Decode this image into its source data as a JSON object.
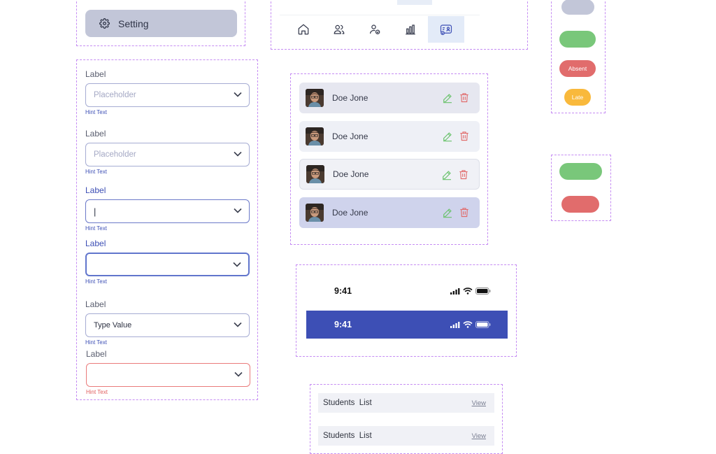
{
  "setting": {
    "label": "Setting",
    "icon": "gear-icon"
  },
  "form": {
    "fields": [
      {
        "label": "Label",
        "placeholder": "Placeholder",
        "value": "",
        "hint": "Hint Text",
        "state": "default"
      },
      {
        "label": "Label",
        "placeholder": "Placeholder",
        "value": "",
        "hint": "Hint Text",
        "state": "hover"
      },
      {
        "label": "Label",
        "placeholder": "",
        "value": "|",
        "hint": "Hint Text",
        "state": "typing"
      },
      {
        "label": "Label",
        "placeholder": "",
        "value": "",
        "hint": "Hint Text",
        "state": "focused"
      },
      {
        "label": "Label",
        "placeholder": "",
        "value": "Type Value",
        "hint": "Hint Text",
        "state": "filled"
      },
      {
        "label": "Label",
        "placeholder": "",
        "value": "",
        "hint": "Hint Text",
        "state": "error"
      }
    ]
  },
  "bottom_nav": {
    "items": [
      {
        "icon": "home-icon"
      },
      {
        "icon": "users-icon"
      },
      {
        "icon": "user-check-icon"
      },
      {
        "icon": "chart-icon"
      },
      {
        "icon": "id-card-icon",
        "active": true
      }
    ]
  },
  "users": {
    "rows": [
      {
        "name": "Doe Jone"
      },
      {
        "name": "Doe Jone"
      },
      {
        "name": "Doe Jone"
      },
      {
        "name": "Doe Jone"
      }
    ]
  },
  "status_bars": {
    "light": {
      "time": "9:41"
    },
    "dark": {
      "time": "9:41"
    }
  },
  "students": {
    "rows": [
      {
        "title": "Students  List",
        "action": "View"
      },
      {
        "title": "Students  List",
        "action": "View"
      }
    ]
  },
  "badges": {
    "absent": "Absent",
    "late": "Late"
  },
  "colors": {
    "primary": "#3d4fb5",
    "neutral_pill": "#c2c6d8",
    "green": "#79c77a",
    "red": "#e16c6c",
    "orange": "#f9b93c"
  }
}
